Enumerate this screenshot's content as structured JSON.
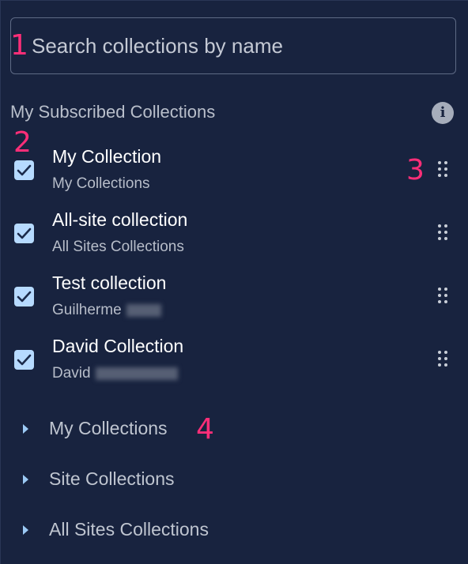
{
  "search": {
    "placeholder": "Search collections by name",
    "value": ""
  },
  "annotations": [
    "1",
    "2",
    "3",
    "4"
  ],
  "section": {
    "title": "My Subscribed Collections",
    "info_icon": "info-icon"
  },
  "subscribed": [
    {
      "title": "My Collection",
      "subtitle": "My Collections",
      "checked": true
    },
    {
      "title": "All-site collection",
      "subtitle": "All Sites Collections",
      "checked": true
    },
    {
      "title": "Test collection",
      "subtitle": "Guilherme",
      "checked": true
    },
    {
      "title": "David Collection",
      "subtitle": "David",
      "checked": true
    }
  ],
  "groups": [
    {
      "label": "My Collections"
    },
    {
      "label": "Site Collections"
    },
    {
      "label": "All Sites Collections"
    }
  ],
  "colors": {
    "background": "#18233f",
    "checkbox": "#b6daff",
    "annotation": "#ff2e78",
    "caret": "#9ccaf5"
  }
}
